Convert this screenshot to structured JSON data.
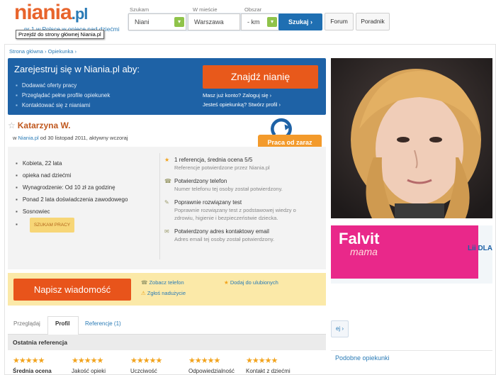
{
  "header": {
    "logo_brand": "niania",
    "logo_tld": ".pl",
    "tagline": "nr 1 w Polsce w opiece nad dziećmi",
    "tooltip": "Przejdź do strony głównej Niania.pl",
    "search": {
      "label_szukam": "Szukam",
      "label_miasto": "W mieście",
      "label_obszar": "Obszar",
      "type_value": "Niani",
      "city_value": "Warszawa",
      "area_value": "- km",
      "button": "Szukaj ›"
    },
    "forum": "Forum",
    "poradnik": "Poradnik"
  },
  "breadcrumb": "Strona główna › Opiekunka ›",
  "banner": {
    "title": "Zarejestruj się w Niania.pl aby:",
    "items": [
      "Dodawać oferty pracy",
      "Przeglądać pełne profile opiekunek",
      "Kontaktować się z nianiami"
    ],
    "find_button": "Znajdź nianię",
    "login_link": "Masz już konto? Zaloguj się ›",
    "create_link": "Jesteś opiekunką? Stwórz profil ›"
  },
  "profile": {
    "name": "Katarzyna W.",
    "site": "Niania.pl",
    "since": "od 30 listopad 2011, aktywny wczoraj",
    "badge": "Praca od zaraz",
    "facts": {
      "gender_age": "Kobieta, 22 lata",
      "care": "opieka nad dziećmi",
      "salary": "Wynagrodzenie: Od 10 zł za godzinę",
      "experience": "Ponad 2 lata doświadczenia zawodowego",
      "city": "Sosnowiec",
      "status": "SZUKAM PRACY"
    },
    "verifications": [
      {
        "title": "1 referencja, średnia ocena 5/5",
        "sub": "Referencje potwierdzone przez Niania.pl",
        "icon": "star-icon"
      },
      {
        "title": "Potwierdzony telefon",
        "sub": "Numer telefonu tej osoby został potwierdzony.",
        "icon": "phone-icon"
      },
      {
        "title": "Poprawnie rozwiązany test",
        "sub": "Poprawnie rozwiązany test z podstawowej wiedzy o zdrowiu, higienie i bezpieczeństwie dziecka.",
        "icon": "test-icon"
      },
      {
        "title": "Potwierdzony adres kontaktowy email",
        "sub": "Adres email tej osoby został potwierdzony.",
        "icon": "email-icon"
      }
    ]
  },
  "actions": {
    "message": "Napisz wiadomość",
    "phone": "Zobacz telefon",
    "report": "Zgłoś nadużycie",
    "favorite": "Dodaj do ulubionych"
  },
  "tabs": [
    "Przeglądaj",
    "Profil",
    "Referencje (1)"
  ],
  "recent": {
    "title": "Ostatnia referencja",
    "ratings": [
      {
        "label": "Średnia ocena",
        "stars": 5
      },
      {
        "label": "Jakość opieki",
        "stars": 5
      },
      {
        "label": "Uczciwość",
        "stars": 5
      },
      {
        "label": "Odpowiedzialność",
        "stars": 5
      },
      {
        "label": "Kontakt z dziećmi",
        "stars": 5
      }
    ]
  },
  "ad": {
    "brand": "Falvit",
    "sub": "mama",
    "side": "Lii DLA"
  },
  "sidebar": {
    "arrow_button": "ej ›",
    "similar": "Podobne opiekunki"
  },
  "colors": {
    "accent_orange": "#e8591b",
    "brand_blue": "#1e62a6",
    "star": "#f2a31c"
  }
}
